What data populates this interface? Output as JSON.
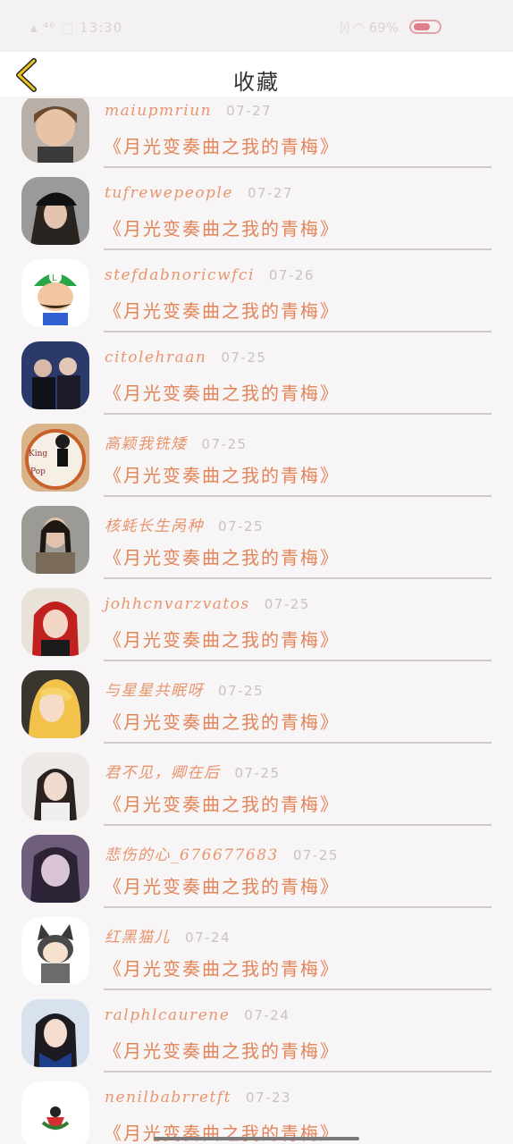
{
  "status_bar": {
    "left_text": "▴ ⁴⁶ ⬚ 13:30",
    "right_text": "ᛞ ◠ 69%",
    "battery_level": 0.69,
    "battery_color": "#e07f8a"
  },
  "header": {
    "title": "收藏",
    "back_icon": "chevron-left-icon",
    "accent": "#e7c51d"
  },
  "colors": {
    "name": "#e8956e",
    "title": "#e38458",
    "date": "#c8c2c4"
  },
  "favorites": [
    {
      "name": "maiupmriun",
      "date": "07-27",
      "title": "《月光变奏曲之我的青梅》",
      "avatar": "photo-child"
    },
    {
      "name": "tufrewepeople",
      "date": "07-27",
      "title": "《月光变奏曲之我的青梅》",
      "avatar": "photo-cap-girl"
    },
    {
      "name": "stefdabnoricwfci",
      "date": "07-26",
      "title": "《月光变奏曲之我的青梅》",
      "avatar": "cartoon-luigi"
    },
    {
      "name": "citolehraan",
      "date": "07-25",
      "title": "《月光变奏曲之我的青梅》",
      "avatar": "photo-stage"
    },
    {
      "name": "高颖我铣矮",
      "date": "07-25",
      "title": "《月光变奏曲之我的青梅》",
      "avatar": "cake-king-of-pop"
    },
    {
      "name": "核蚝长生呙种",
      "date": "07-25",
      "title": "《月光变奏曲之我的青梅》",
      "avatar": "photo-braids"
    },
    {
      "name": "johhcnvarzvatos",
      "date": "07-25",
      "title": "《月光变奏曲之我的青梅》",
      "avatar": "photo-red-hood"
    },
    {
      "name": "与星星共眠呀",
      "date": "07-25",
      "title": "《月光变奏曲之我的青梅》",
      "avatar": "anime-blonde"
    },
    {
      "name": "君不见，卿在后",
      "date": "07-25",
      "title": "《月光变奏曲之我的青梅》",
      "avatar": "photo-long-hair"
    },
    {
      "name": "悲伤的心_676677683",
      "date": "07-25",
      "title": "《月光变奏曲之我的青梅》",
      "avatar": "photo-purple"
    },
    {
      "name": "红黑猫儿",
      "date": "07-24",
      "title": "《月光变奏曲之我的青梅》",
      "avatar": "anime-cat-ears"
    },
    {
      "name": "ralphlcaurene",
      "date": "07-24",
      "title": "《月光变奏曲之我的青梅》",
      "avatar": "photo-uniform"
    },
    {
      "name": "nenilbabrretft",
      "date": "07-23",
      "title": "《月光变奏曲之我的青梅》",
      "avatar": "cartoon-mini"
    }
  ]
}
